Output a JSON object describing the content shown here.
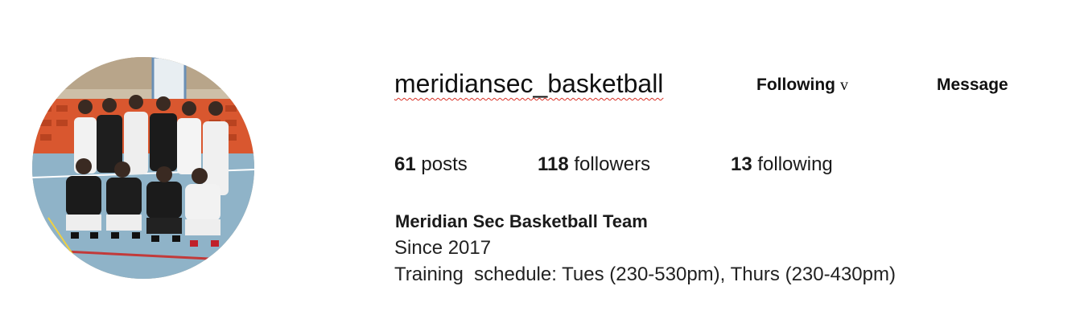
{
  "profile": {
    "username": "meridiansec_basketball",
    "avatar_alt": "team-photo-avatar",
    "follow_button": "Following",
    "follow_chevron": "v",
    "message_button": "Message"
  },
  "stats": {
    "posts_count": "61",
    "posts_label": "posts",
    "followers_count": "118",
    "followers_label": "followers",
    "following_count": "13",
    "following_label": "following"
  },
  "bio": {
    "name": "Meridian Sec Basketball Team",
    "line1": "Since 2017",
    "line2": "Training  schedule: Tues (230-530pm), Thurs (230-430pm)"
  },
  "colors": {
    "text": "#111111",
    "spellcheck_underline": "#d93025",
    "court_floor": "#8fb3c8",
    "seats": "#e0603a"
  }
}
